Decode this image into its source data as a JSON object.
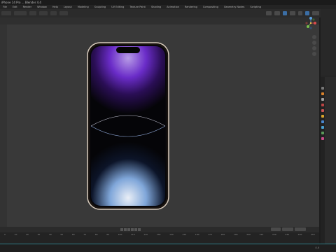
{
  "window": {
    "title": "iPhone 14 Pro ... Blender 4.4"
  },
  "menu": [
    "File",
    "Edit",
    "Render",
    "Window",
    "Help",
    "Layout",
    "Modeling",
    "Sculpting",
    "UV Editing",
    "Texture Paint",
    "Shading",
    "Animation",
    "Rendering",
    "Compositing",
    "Geometry Nodes",
    "Scripting"
  ],
  "timeline": {
    "ticks": [
      "0",
      "10",
      "20",
      "30",
      "40",
      "50",
      "60",
      "70",
      "80",
      "90",
      "100",
      "110",
      "120",
      "130",
      "140",
      "150",
      "160",
      "170",
      "180",
      "190",
      "200",
      "210",
      "220",
      "230",
      "240",
      "250"
    ]
  },
  "status": {
    "version": "4.4"
  },
  "colors": {
    "accent_status": "#2e7b84",
    "viewport_bg": "#393939",
    "phone_frame": "#d9cdbf",
    "screen_purple": "#6a2cc8",
    "screen_blue": "#7fa6d9"
  },
  "icons": {
    "gizmo": "navigation-gizmo-icon",
    "zoom": "zoom-icon",
    "pan": "hand-icon",
    "camera": "camera-icon"
  }
}
